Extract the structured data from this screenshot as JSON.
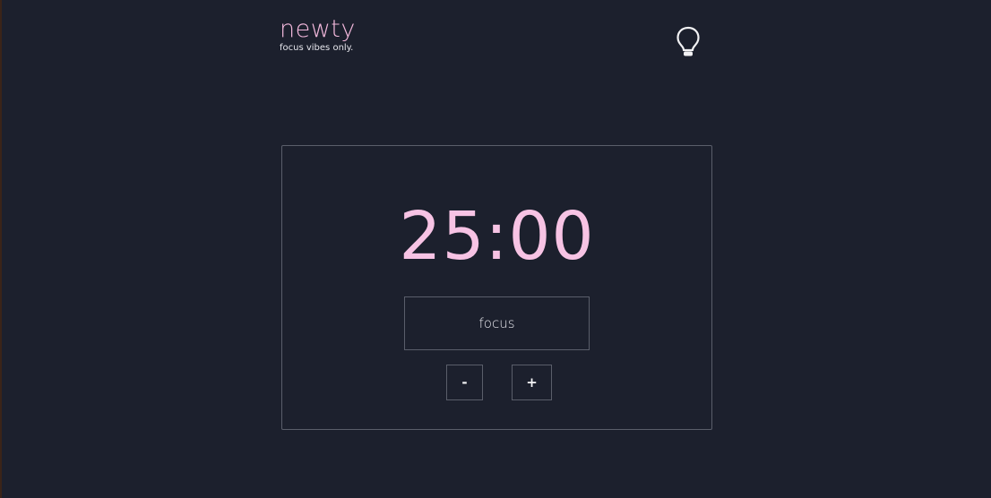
{
  "brand": {
    "title": "newty",
    "tagline": "focus vibes only."
  },
  "theme_toggle": {
    "icon": "lightbulb-icon"
  },
  "timer": {
    "display": "25:00",
    "mode_label": "focus",
    "decrement_label": "-",
    "increment_label": "+"
  },
  "colors": {
    "background": "#1c202d",
    "accent": "#f7c3e4",
    "border": "#5a5e6a",
    "text": "#e6e6ec"
  }
}
